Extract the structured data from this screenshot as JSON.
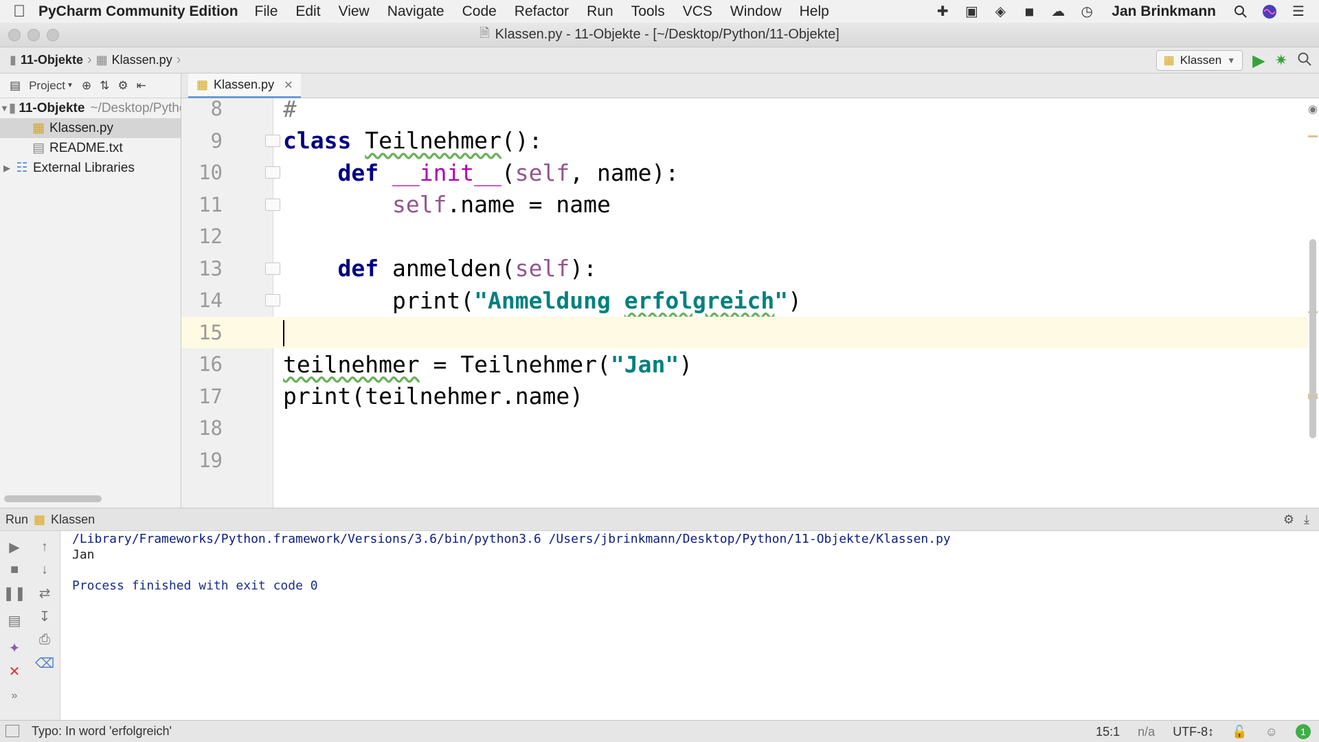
{
  "menubar": {
    "app_name": "PyCharm Community Edition",
    "items": [
      "File",
      "Edit",
      "View",
      "Navigate",
      "Code",
      "Refactor",
      "Run",
      "Tools",
      "VCS",
      "Window",
      "Help"
    ],
    "user": "Jan Brinkmann"
  },
  "window": {
    "title": "Klassen.py - 11-Objekte - [~/Desktop/Python/11-Objekte]"
  },
  "navbar": {
    "crumb_project": "11-Objekte",
    "crumb_file": "Klassen.py",
    "run_config": "Klassen"
  },
  "project": {
    "toolbar_label": "Project",
    "tree": [
      {
        "label": "11-Objekte",
        "hint": "~/Desktop/Python/11-Objekte"
      },
      {
        "label": "Klassen.py"
      },
      {
        "label": "README.txt"
      },
      {
        "label": "External Libraries"
      }
    ]
  },
  "editor": {
    "tab_label": "Klassen.py",
    "lines": [
      {
        "n": "8",
        "text": "#"
      },
      {
        "n": "9",
        "kw": "class ",
        "name": "Teilnehmer",
        "rest": "():"
      },
      {
        "n": "10",
        "indent": "    ",
        "kw": "def ",
        "magic": "__init__",
        "p1": "(",
        "self": "self",
        "p2": ", name):"
      },
      {
        "n": "11",
        "indent": "        ",
        "self": "self",
        "rest": ".name = name"
      },
      {
        "n": "12"
      },
      {
        "n": "13",
        "indent": "    ",
        "kw": "def ",
        "name": "anmelden",
        "p1": "(",
        "self": "self",
        "p2": "):"
      },
      {
        "n": "14",
        "indent": "        ",
        "pre": "print(",
        "str1": "\"Anmeldung ",
        "str2": "erfolgreich",
        "str3": "\"",
        "post": ")"
      },
      {
        "n": "15"
      },
      {
        "n": "16",
        "name": "teilnehmer",
        "mid": " = Teilnehmer(",
        "str1": "\"Jan\"",
        "post": ")"
      },
      {
        "n": "17",
        "text": "print(teilnehmer.name)"
      },
      {
        "n": "18"
      },
      {
        "n": "19"
      }
    ]
  },
  "run": {
    "label": "Run",
    "config": "Klassen",
    "output": [
      "/Library/Frameworks/Python.framework/Versions/3.6/bin/python3.6 /Users/jbrinkmann/Desktop/Python/11-Objekte/Klassen.py",
      "Jan",
      "",
      "Process finished with exit code 0"
    ]
  },
  "statusbar": {
    "message": "Typo: In word 'erfolgreich'",
    "position": "15:1",
    "separator": "n/a",
    "encoding": "UTF-8↕",
    "badge": "1"
  }
}
